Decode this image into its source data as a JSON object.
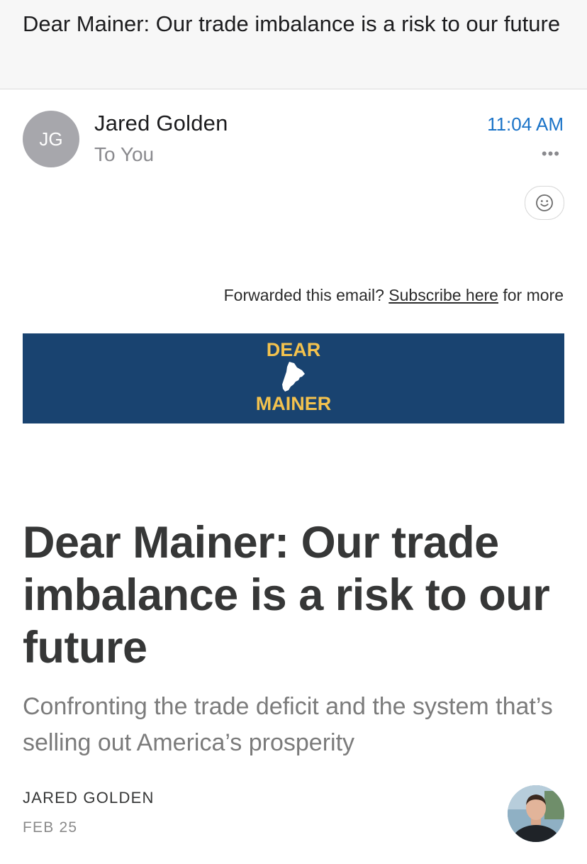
{
  "email": {
    "subject": "Dear Mainer: Our trade imbalance is a risk to our future",
    "sender_initials": "JG",
    "sender_name": "Jared Golden",
    "recipient": "To You",
    "time": "11:04 AM",
    "more_icon": "ellipsis-icon",
    "react_icon": "smiley-icon"
  },
  "body": {
    "forward_prefix": "Forwarded this email?",
    "subscribe_link": "Subscribe here",
    "forward_suffix": "for more",
    "banner": {
      "line1": "DEAR",
      "line2": "MAINER",
      "background": "#194370",
      "text_color": "#f3c24e"
    },
    "title": "Dear Mainer: Our trade imbalance is a risk to our future",
    "subtitle": "Confronting the trade deficit and the system that’s selling out America’s prosperity",
    "author": "JARED GOLDEN",
    "date": "FEB 25"
  },
  "colors": {
    "accent": "#1a73c8",
    "avatar_bg": "#a7a7ac"
  }
}
